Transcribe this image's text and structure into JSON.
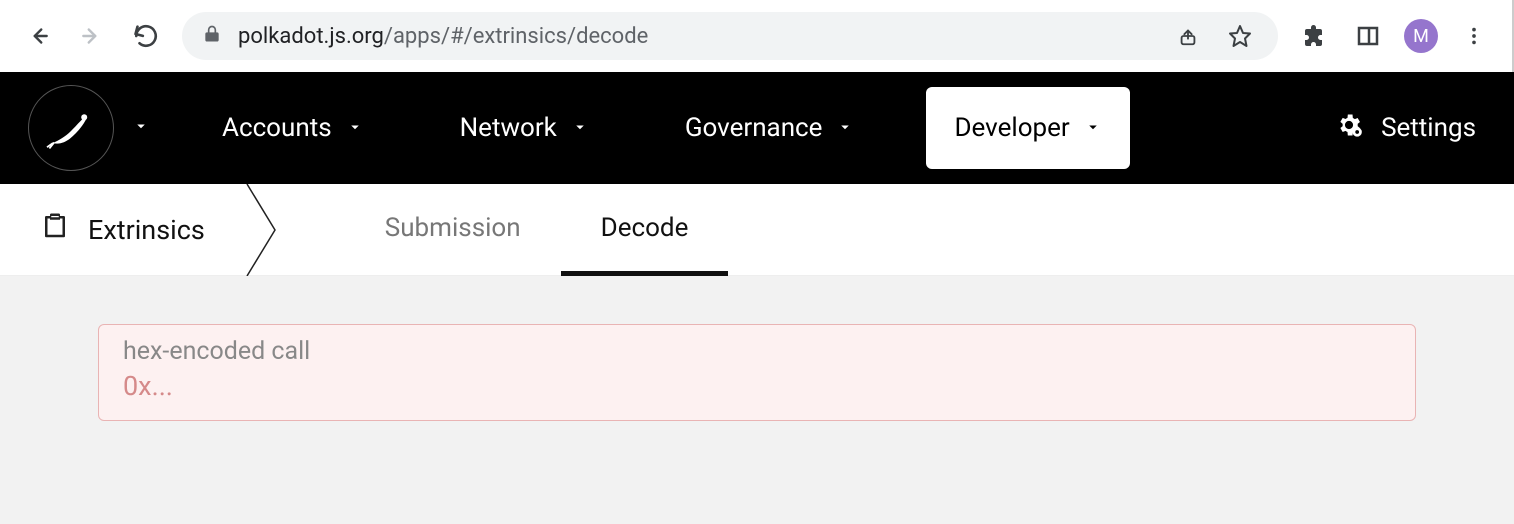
{
  "browser": {
    "url_host": "polkadot.js.org",
    "url_path": "/apps/#/extrinsics/decode",
    "avatar_letter": "M"
  },
  "nav": {
    "accounts": "Accounts",
    "network": "Network",
    "governance": "Governance",
    "developer": "Developer",
    "settings": "Settings"
  },
  "submenu": {
    "breadcrumb": "Extrinsics",
    "tabs": {
      "submission": "Submission",
      "decode": "Decode"
    }
  },
  "form": {
    "hex_label": "hex-encoded call",
    "hex_placeholder": "0x..."
  }
}
